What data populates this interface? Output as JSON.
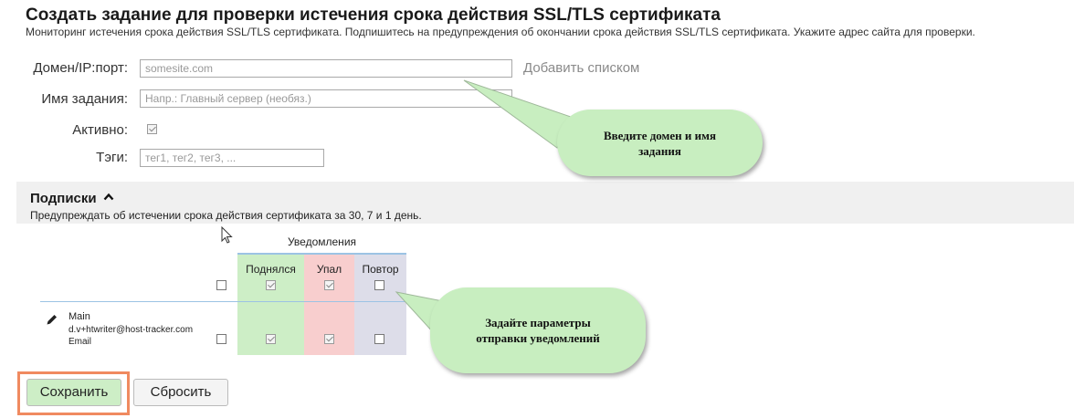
{
  "page": {
    "title": "Создать задание для проверки истечения срока действия SSL/TLS сертификата",
    "subtitle": "Мониторинг истечения срока действия SSL/TLS сертификата. Подпишитесь на предупреждения об окончании срока действия SSL/TLS сертификата. Укажите адрес сайта для проверки."
  },
  "form": {
    "domain_label": "Домен/IP:порт:",
    "domain_placeholder": "somesite.com",
    "add_list_link": "Добавить списком",
    "task_name_label": "Имя задания:",
    "task_name_placeholder": "Напр.: Главный сервер (необяз.)",
    "active_label": "Активно:",
    "active_checked": true,
    "tags_label": "Тэги:",
    "tags_placeholder": "тег1, тег2, тег3, ..."
  },
  "subscriptions": {
    "title": "Подписки",
    "description": "Предупреждать об истечении срока действия сертификата за 30, 7 и 1 день.",
    "notifications_header": "Уведомления",
    "columns": [
      {
        "label": "Поднялся",
        "color": "#cdeec6"
      },
      {
        "label": "Упал",
        "color": "#f8cece"
      },
      {
        "label": "Повтор",
        "color": "#dddde9"
      }
    ],
    "header_row_checks": [
      false,
      true,
      true,
      false
    ],
    "contact": {
      "name": "Main",
      "email": "d.v+htwriter@host-tracker.com",
      "type": "Email",
      "checks": [
        false,
        true,
        true,
        false
      ]
    }
  },
  "buttons": {
    "save": "Сохранить",
    "reset": "Сбросить",
    "save_highlight_color": "#f08a60"
  },
  "callouts": {
    "first": "Введите домен и имя задания",
    "second": "Задайте параметры отправки уведомлений",
    "color": "#c8eec0"
  }
}
